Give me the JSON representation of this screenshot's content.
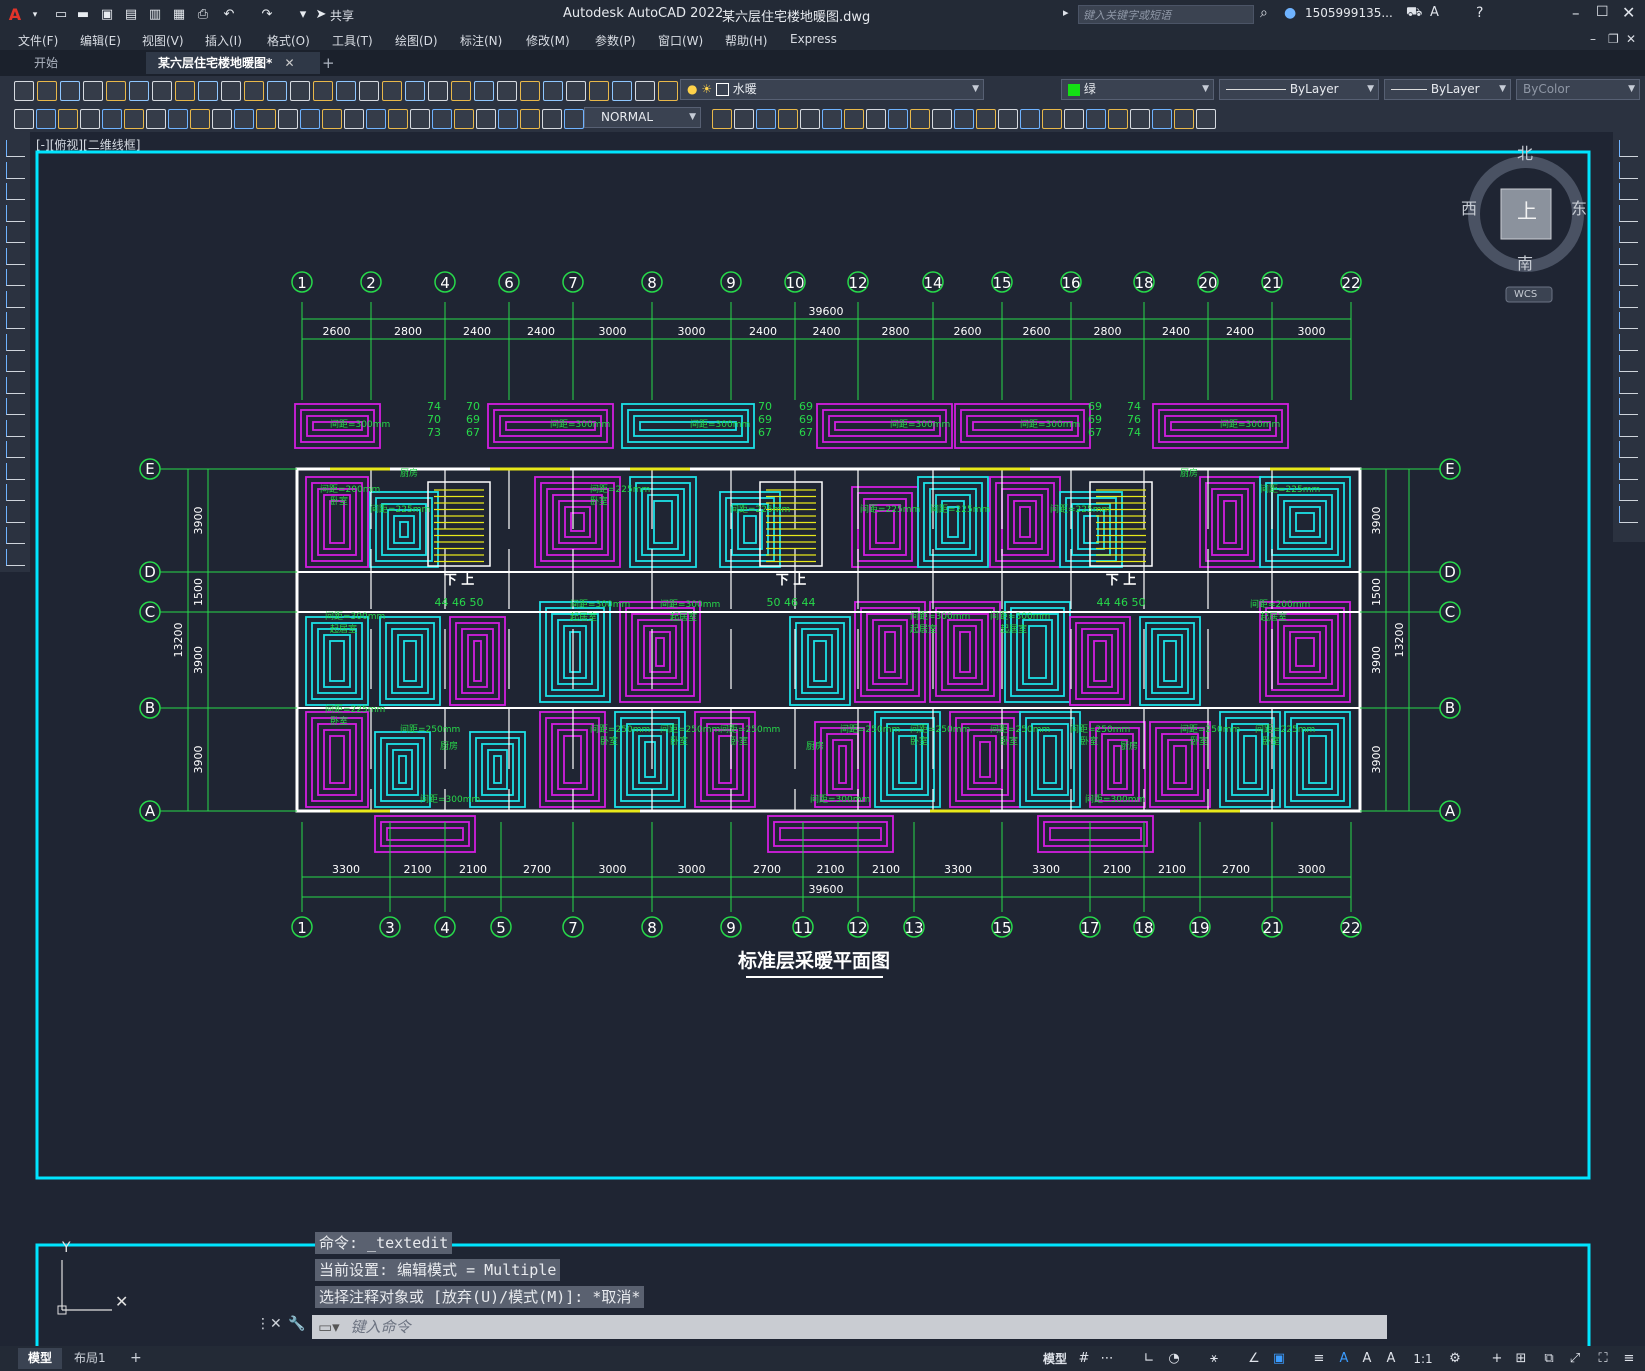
{
  "titlebar": {
    "app_title": "Autodesk AutoCAD 2022",
    "doc_title": "某六层住宅楼地暖图.dwg",
    "share_label": "共享",
    "search_placeholder": "键入关键字或短语",
    "user_name": "1505999135..."
  },
  "menu": [
    "文件(F)",
    "编辑(E)",
    "视图(V)",
    "插入(I)",
    "格式(O)",
    "工具(T)",
    "绘图(D)",
    "标注(N)",
    "修改(M)",
    "参数(P)",
    "窗口(W)",
    "帮助(H)",
    "Express"
  ],
  "tabs": {
    "start": "开始",
    "active": "某六层住宅楼地暖图*"
  },
  "properties": {
    "layer": "水暖",
    "color": "绿",
    "linetype": "ByLayer",
    "lineweight": "ByLayer",
    "plotstyle": "ByColor",
    "dimstyle": "NORMAL"
  },
  "viewport_label": "[-][俯视][二维线框]",
  "viewcube": {
    "north": "北",
    "south": "南",
    "east": "东",
    "west": "西",
    "top": "上",
    "wcs": "WCS"
  },
  "drawing": {
    "title": "标准层采暖平面图",
    "top_axes": [
      "1",
      "2",
      "4",
      "6",
      "7",
      "8",
      "9",
      "10",
      "12",
      "14",
      "15",
      "16",
      "18",
      "20",
      "21",
      "22"
    ],
    "top_dims": [
      "2600",
      "2800",
      "2400",
      "2400",
      "3000",
      "3000",
      "2400",
      "2400",
      "2800",
      "2600",
      "2600",
      "2800",
      "2400",
      "2400",
      "3000"
    ],
    "top_total": "39600",
    "bottom_axes": [
      "1",
      "3",
      "4",
      "5",
      "7",
      "8",
      "9",
      "11",
      "12",
      "13",
      "15",
      "17",
      "18",
      "19",
      "21",
      "22"
    ],
    "bottom_dims": [
      "3300",
      "2100",
      "2100",
      "2700",
      "3000",
      "3000",
      "2700",
      "2100",
      "2100",
      "3300",
      "3300",
      "2100",
      "2100",
      "2700",
      "3000"
    ],
    "bottom_total": "39600",
    "row_axes": [
      "E",
      "D",
      "C",
      "B",
      "A"
    ],
    "side_dims": [
      "3900",
      "1500",
      "3900",
      "3900"
    ],
    "side_total": "13200",
    "stair_labels": [
      "下 上",
      "下 上",
      "下 上"
    ],
    "stair_numbers_bottom": [
      "44 46 50",
      "50 46 44",
      "44 46 50"
    ],
    "stair_numbers_top": [
      [
        "74",
        "70",
        "73"
      ],
      [
        "70",
        "69",
        "67"
      ],
      [
        "70",
        "69",
        "67"
      ],
      [
        "69",
        "69",
        "67"
      ],
      [
        "69",
        "69",
        "67"
      ],
      [
        "74",
        "76",
        "74"
      ]
    ],
    "room_notes": [
      "间距=300mm",
      "间距=200mm",
      "间距=225mm",
      "间距=250mm",
      "卧室",
      "起居室",
      "厨房"
    ]
  },
  "command": {
    "line1": "命令: _textedit",
    "line2": "当前设置: 编辑模式 = Multiple",
    "line3": "选择注释对象或 [放弃(U)/模式(M)]: *取消*",
    "input_placeholder": "键入命令"
  },
  "status": {
    "layout_tabs": [
      "模型",
      "布局1"
    ],
    "model_label": "模型",
    "scale": "1:1"
  },
  "colors": {
    "accent": "#00e5ff",
    "axis_green": "#27d94a",
    "pipe_magenta": "#d21ee0",
    "pipe_cyan": "#1ce0e6",
    "wall_white": "#ffffff",
    "stair_yellow": "#e8e81a",
    "dim_red": "#ff3030"
  }
}
